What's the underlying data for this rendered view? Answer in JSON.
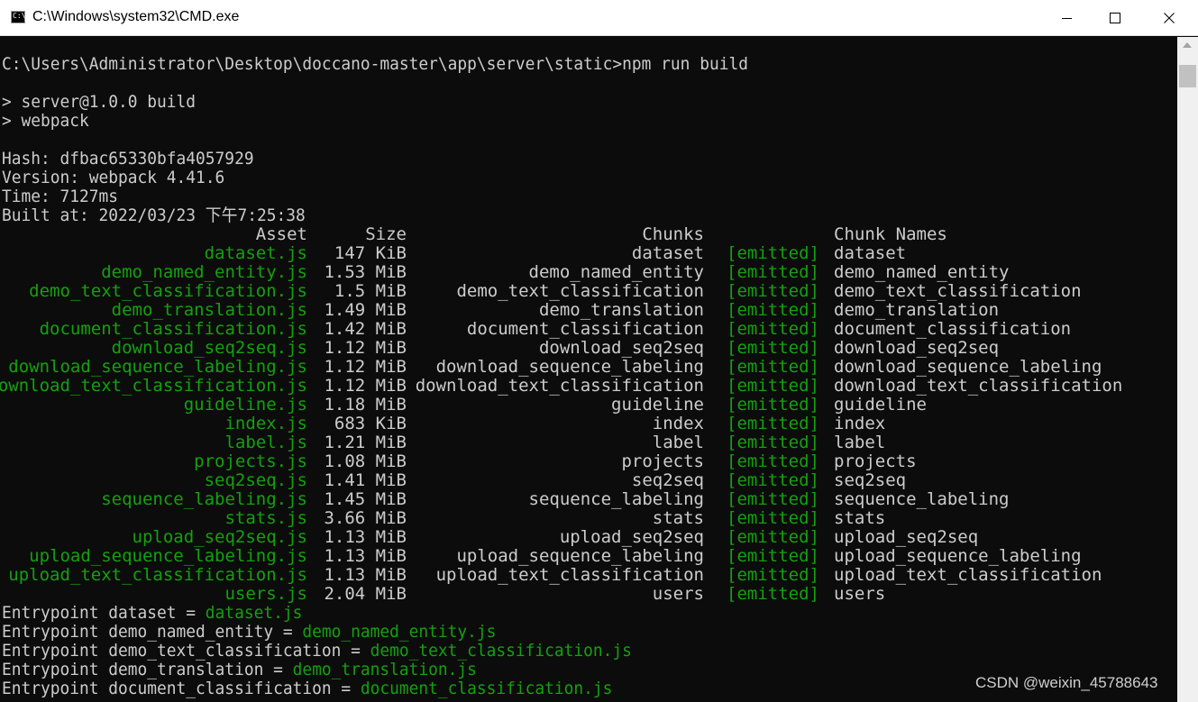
{
  "window": {
    "title": "C:\\Windows\\system32\\CMD.exe",
    "icon": "cmd-icon",
    "buttons": {
      "minimize": "minimize-icon",
      "maximize": "maximize-icon",
      "close": "close-icon"
    }
  },
  "colors": {
    "background": "#0c0c0c",
    "text": "#cccccc",
    "green": "#13a10e"
  },
  "console": {
    "command_line": "C:\\Users\\Administrator\\Desktop\\doccano-master\\app\\server\\static>npm run build",
    "npm_lines": [
      "> server@1.0.0 build",
      "> webpack"
    ],
    "hash_line": "Hash: dfbac65330bfa4057929",
    "version_line": "Version: webpack 4.41.6",
    "time_line": "Time: 7127ms",
    "built_line": "Built at: 2022/03/23 下午7:25:38",
    "headers": {
      "asset": "Asset",
      "size": "Size",
      "chunks": "Chunks",
      "chunk_names": "Chunk Names"
    },
    "assets": [
      {
        "asset": "dataset.js",
        "size": "147 KiB",
        "chunks": "dataset",
        "status": "[emitted]",
        "name": "dataset"
      },
      {
        "asset": "demo_named_entity.js",
        "size": "1.53 MiB",
        "chunks": "demo_named_entity",
        "status": "[emitted]",
        "name": "demo_named_entity"
      },
      {
        "asset": "demo_text_classification.js",
        "size": "1.5 MiB",
        "chunks": "demo_text_classification",
        "status": "[emitted]",
        "name": "demo_text_classification"
      },
      {
        "asset": "demo_translation.js",
        "size": "1.49 MiB",
        "chunks": "demo_translation",
        "status": "[emitted]",
        "name": "demo_translation"
      },
      {
        "asset": "document_classification.js",
        "size": "1.42 MiB",
        "chunks": "document_classification",
        "status": "[emitted]",
        "name": "document_classification"
      },
      {
        "asset": "download_seq2seq.js",
        "size": "1.12 MiB",
        "chunks": "download_seq2seq",
        "status": "[emitted]",
        "name": "download_seq2seq"
      },
      {
        "asset": "download_sequence_labeling.js",
        "size": "1.12 MiB",
        "chunks": "download_sequence_labeling",
        "status": "[emitted]",
        "name": "download_sequence_labeling"
      },
      {
        "asset": "download_text_classification.js",
        "size": "1.12 MiB",
        "chunks": "download_text_classification",
        "status": "[emitted]",
        "name": "download_text_classification"
      },
      {
        "asset": "guideline.js",
        "size": "1.18 MiB",
        "chunks": "guideline",
        "status": "[emitted]",
        "name": "guideline"
      },
      {
        "asset": "index.js",
        "size": "683 KiB",
        "chunks": "index",
        "status": "[emitted]",
        "name": "index"
      },
      {
        "asset": "label.js",
        "size": "1.21 MiB",
        "chunks": "label",
        "status": "[emitted]",
        "name": "label"
      },
      {
        "asset": "projects.js",
        "size": "1.08 MiB",
        "chunks": "projects",
        "status": "[emitted]",
        "name": "projects"
      },
      {
        "asset": "seq2seq.js",
        "size": "1.41 MiB",
        "chunks": "seq2seq",
        "status": "[emitted]",
        "name": "seq2seq"
      },
      {
        "asset": "sequence_labeling.js",
        "size": "1.45 MiB",
        "chunks": "sequence_labeling",
        "status": "[emitted]",
        "name": "sequence_labeling"
      },
      {
        "asset": "stats.js",
        "size": "3.66 MiB",
        "chunks": "stats",
        "status": "[emitted]",
        "name": "stats"
      },
      {
        "asset": "upload_seq2seq.js",
        "size": "1.13 MiB",
        "chunks": "upload_seq2seq",
        "status": "[emitted]",
        "name": "upload_seq2seq"
      },
      {
        "asset": "upload_sequence_labeling.js",
        "size": "1.13 MiB",
        "chunks": "upload_sequence_labeling",
        "status": "[emitted]",
        "name": "upload_sequence_labeling"
      },
      {
        "asset": "upload_text_classification.js",
        "size": "1.13 MiB",
        "chunks": "upload_text_classification",
        "status": "[emitted]",
        "name": "upload_text_classification"
      },
      {
        "asset": "users.js",
        "size": "2.04 MiB",
        "chunks": "users",
        "status": "[emitted]",
        "name": "users"
      }
    ],
    "entrypoints": [
      {
        "prefix": "Entrypoint dataset = ",
        "file": "dataset.js"
      },
      {
        "prefix": "Entrypoint demo_named_entity = ",
        "file": "demo_named_entity.js"
      },
      {
        "prefix": "Entrypoint demo_text_classification = ",
        "file": "demo_text_classification.js"
      },
      {
        "prefix": "Entrypoint demo_translation = ",
        "file": "demo_translation.js"
      },
      {
        "prefix": "Entrypoint document_classification = ",
        "file": "document_classification.js"
      }
    ]
  },
  "watermark": "CSDN @weixin_45788643"
}
